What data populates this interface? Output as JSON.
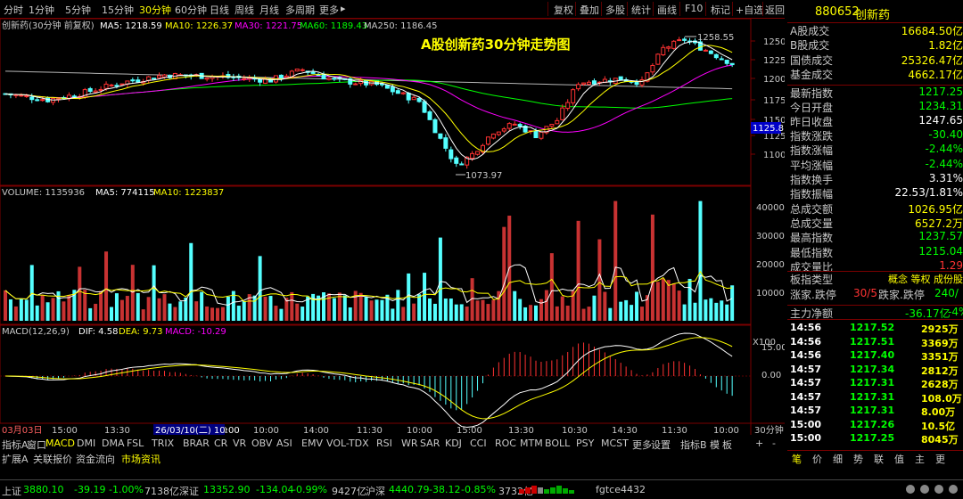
{
  "toolbar": {
    "periods": [
      "分时",
      "1分钟",
      "5分钟",
      "15分钟",
      "30分钟",
      "60分钟",
      "日线",
      "周线",
      "月线",
      "多周期",
      "更多"
    ],
    "active_period": "30分钟",
    "buttons": [
      "复权",
      "叠加",
      "多股",
      "统计",
      "画线",
      "F10",
      "标记",
      "+自选",
      "返回"
    ]
  },
  "main": {
    "title_overlay": "A股创新药30分钟走势图",
    "stock_name": "创新药(30分钟 前复权)",
    "ma": [
      {
        "label": "MA5: 1218.59",
        "color": "#ffffff"
      },
      {
        "label": "MA10: 1226.37",
        "color": "#ffff00"
      },
      {
        "label": "MA30: 1221.75",
        "color": "#ff00ff"
      },
      {
        "label": "MA60: 1189.43",
        "color": "#00ff00"
      },
      {
        "label": "MA250: 1186.45",
        "color": "#c8c8c8"
      }
    ],
    "y_ticks": [
      "1250",
      "1225",
      "1200",
      "1175",
      "1150",
      "1125",
      "1100"
    ],
    "high_label": "1258.55",
    "low_label": "1073.97",
    "current_price_tag": "1125.8"
  },
  "volume": {
    "label": "VOLUME: 1135936",
    "ma5": "MA5: 774115",
    "ma10": "MA10: 1223837",
    "y_ticks": [
      "40000",
      "30000",
      "20000",
      "10000"
    ],
    "unit": "X100"
  },
  "macd": {
    "label": "MACD(12,26,9)",
    "dif": "DIF: 4.58",
    "dea": "DEA: 9.73",
    "macd": "MACD: -10.29",
    "y_ticks": [
      "15.00",
      "0.00"
    ]
  },
  "x_axis": {
    "labels": [
      "03月03日",
      "15:00",
      "13:30",
      "15:00",
      "11:30",
      "10:00",
      "14:00",
      "11:30",
      "10:00",
      "15:00",
      "13:30",
      "10:30",
      "14:30",
      "11:30",
      "10:00"
    ],
    "cursor_label": "26/03/10(二) 10:00",
    "period_label": "30分钟"
  },
  "indicator_tabs": [
    "指标A",
    "窗口",
    "MACD",
    "DMI",
    "DMA",
    "FSL",
    "TRIX",
    "BRAR",
    "CR",
    "VR",
    "OBV",
    "ASI",
    "EMV",
    "VOL-TDX",
    "RSI",
    "WR",
    "SAR",
    "KDJ",
    "CCI",
    "ROC",
    "MTM",
    "BOLL",
    "PSY",
    "MCST",
    "更多",
    "设置"
  ],
  "indicator_active": "MACD",
  "indicator_right": [
    "指标B",
    "模",
    "板",
    "+",
    "-"
  ],
  "extra_tabs": [
    "扩展A",
    "关联报价",
    "资金流向",
    "市场资讯"
  ],
  "extra_active": "市场资讯",
  "right_panel": {
    "code": "880652",
    "name": "创新药",
    "rows": [
      {
        "label": "A股成交",
        "value": "16684.50亿",
        "color": "#ffff00"
      },
      {
        "label": "B股成交",
        "value": "1.82亿",
        "color": "#ffff00"
      },
      {
        "label": "国债成交",
        "value": "25326.47亿",
        "color": "#ffff00"
      },
      {
        "label": "基金成交",
        "value": "4662.17亿",
        "color": "#ffff00"
      },
      {
        "label": "最新指数",
        "value": "1217.25",
        "color": "#00ff00"
      },
      {
        "label": "今日开盘",
        "value": "1234.31",
        "color": "#00ff00"
      },
      {
        "label": "昨日收盘",
        "value": "1247.65",
        "color": "#ffffff"
      },
      {
        "label": "指数涨跌",
        "value": "-30.40",
        "color": "#00ff00"
      },
      {
        "label": "指数涨幅",
        "value": "-2.44%",
        "color": "#00ff00"
      },
      {
        "label": "平均涨幅",
        "value": "-2.44%",
        "color": "#00ff00"
      },
      {
        "label": "指数换手",
        "value": "3.31%",
        "color": "#ffffff"
      },
      {
        "label": "指数振幅",
        "value": "22.53/1.81%",
        "color": "#ffffff"
      },
      {
        "label": "总成交额",
        "value": "1026.95亿",
        "color": "#ffff00"
      },
      {
        "label": "总成交量",
        "value": "6527.2万",
        "color": "#ffff00"
      },
      {
        "label": "最高指数",
        "value": "1237.57",
        "color": "#00ff00"
      },
      {
        "label": "最低指数",
        "value": "1215.04",
        "color": "#00ff00"
      },
      {
        "label": "成交量比",
        "value": "1.29",
        "color": "#ff3333"
      }
    ],
    "board_type_label": "板指类型",
    "board_type_value": "概念 等权 成份股",
    "updown_label": "涨家.跌停",
    "updown_value": "30/5",
    "updown2_label": "跌家.跌停",
    "updown2_value": "240/",
    "mainflow_label": "主力净额",
    "mainflow_value": "-36.17亿",
    "mainflow_pct": "-4%",
    "ticks": [
      {
        "time": "14:56",
        "price": "1217.52",
        "vol": "2925万"
      },
      {
        "time": "14:56",
        "price": "1217.51",
        "vol": "3369万"
      },
      {
        "time": "14:56",
        "price": "1217.40",
        "vol": "3351万"
      },
      {
        "time": "14:57",
        "price": "1217.34",
        "vol": "2812万"
      },
      {
        "time": "14:57",
        "price": "1217.31",
        "vol": "2628万"
      },
      {
        "time": "14:57",
        "price": "1217.31",
        "vol": "108.0万"
      },
      {
        "time": "14:57",
        "price": "1217.31",
        "vol": "8.00万"
      },
      {
        "time": "15:00",
        "price": "1217.26",
        "vol": "10.5亿"
      },
      {
        "time": "15:00",
        "price": "1217.25",
        "vol": "8045万"
      }
    ],
    "bottom_tabs": [
      "笔",
      "价",
      "细",
      "势",
      "联",
      "值",
      "主",
      "更"
    ]
  },
  "statusbar": {
    "sh": {
      "name": "上证",
      "price": "3880.10",
      "chg": "-39.19",
      "pct": "-1.00%",
      "amt": "7138亿"
    },
    "sz": {
      "name": "深证",
      "price": "13352.90",
      "chg": "-134.04",
      "pct": "-0.99%",
      "amt": "9427亿"
    },
    "hs": {
      "name": "沪深",
      "price": "4440.79",
      "chg": "-38.12",
      "pct": "-0.85%",
      "amt": "3732亿"
    },
    "account": "fgtce4432"
  }
}
